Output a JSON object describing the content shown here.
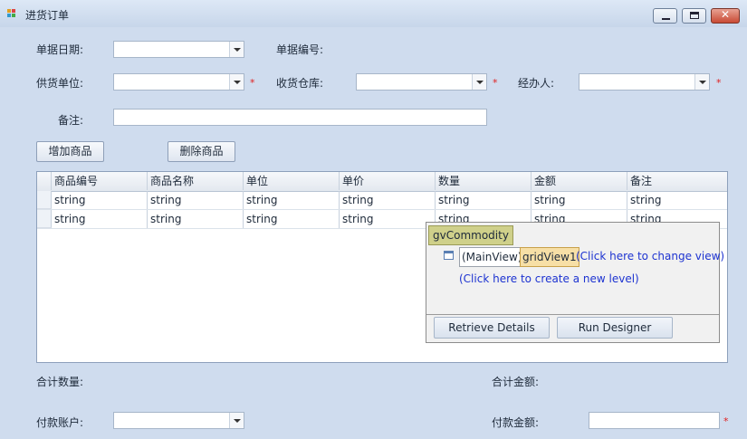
{
  "window": {
    "title": "进货订单",
    "minimize_label": "",
    "maximize_label": "",
    "close_label": "✕"
  },
  "form": {
    "date_label": "单据日期:",
    "doc_no_label": "单据编号:",
    "supplier_label": "供货单位:",
    "warehouse_label": "收货仓库:",
    "handler_label": "经办人:",
    "remark_label": "备注:",
    "required_mark": "*",
    "date_value": "",
    "supplier_value": "",
    "warehouse_value": "",
    "handler_value": "",
    "remark_value": ""
  },
  "buttons": {
    "add_product": "增加商品",
    "delete_product": "删除商品"
  },
  "grid": {
    "columns": [
      "商品编号",
      "商品名称",
      "单位",
      "单价",
      "数量",
      "金额",
      "备注"
    ],
    "rows": [
      [
        "string",
        "string",
        "string",
        "string",
        "string",
        "string",
        "string"
      ],
      [
        "string",
        "string",
        "string",
        "string",
        "string",
        "string",
        "string"
      ]
    ]
  },
  "designer": {
    "grid_name": "gvCommodity",
    "main_view": "(MainView)",
    "view_name": "gridView1",
    "change_view_link": "(Click here to change view)",
    "new_level_link": "(Click here to create a new level)",
    "retrieve_details": "Retrieve Details",
    "run_designer": "Run Designer"
  },
  "footer": {
    "total_qty_label": "合计数量:",
    "total_amount_label": "合计金额:",
    "pay_account_label": "付款账户:",
    "pay_amount_label": "付款金额:",
    "pay_account_value": "",
    "pay_amount_value": ""
  },
  "colors": {
    "background": "#cfdcee",
    "required": "#e02020",
    "link": "#1d33d1"
  }
}
